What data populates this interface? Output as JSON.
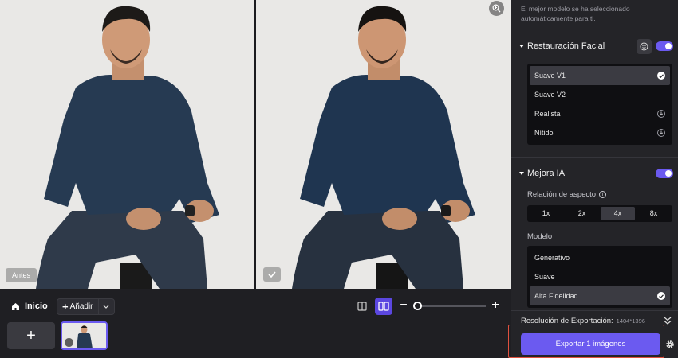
{
  "preview": {
    "before_label": "Antes",
    "after_icon": "check-icon",
    "zoom_icon": "zoom-in-icon"
  },
  "bottom_bar": {
    "home_label": "Inicio",
    "add_label": "Añadir",
    "view_modes": [
      "single-view-icon",
      "split-view-icon"
    ],
    "zoom_minus": "−",
    "zoom_plus": "+",
    "new_tile": "+"
  },
  "panel": {
    "auto_note": "El mejor modelo se ha seleccionado automáticamente para ti.",
    "face": {
      "title": "Restauración Facial",
      "enabled": true,
      "options": [
        {
          "label": "Suave V1",
          "selected": true,
          "icon": "check-icon"
        },
        {
          "label": "Suave V2",
          "selected": false,
          "icon": ""
        },
        {
          "label": "Realista",
          "selected": false,
          "icon": "download-icon"
        },
        {
          "label": "Nítido",
          "selected": false,
          "icon": "download-icon"
        }
      ]
    },
    "enhance": {
      "title": "Mejora IA",
      "enabled": true,
      "ratio_label": "Relación de aspecto",
      "ratios": [
        {
          "label": "1x",
          "selected": false
        },
        {
          "label": "2x",
          "selected": false
        },
        {
          "label": "4x",
          "selected": true
        },
        {
          "label": "8x",
          "selected": false
        }
      ],
      "model_label": "Modelo",
      "models": [
        {
          "label": "Generativo",
          "selected": false
        },
        {
          "label": "Suave",
          "selected": false
        },
        {
          "label": "Alta Fidelidad",
          "selected": true
        }
      ]
    },
    "export": {
      "resolution_label": "Resolución de Exportación:",
      "resolution_value": "1404*1396",
      "button_label": "Exportar 1 imágenes"
    }
  },
  "colors": {
    "accent": "#6b5af0",
    "highlight_border": "#e0513f",
    "panel_bg": "#242428"
  }
}
